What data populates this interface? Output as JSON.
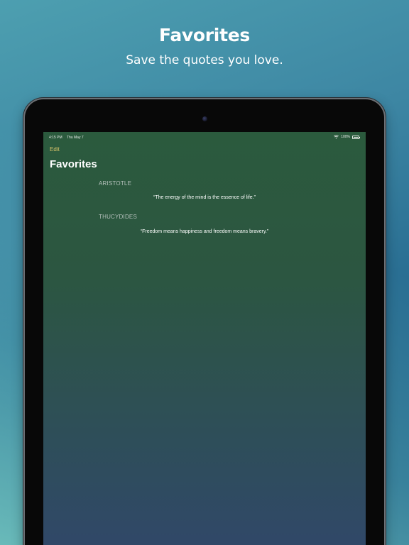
{
  "promo": {
    "headline": "Favorites",
    "subhead": "Save the quotes you love."
  },
  "status_bar": {
    "time": "4:15 PM",
    "date": "Thu May 7",
    "battery": "100%"
  },
  "nav": {
    "edit_label": "Edit",
    "title": "Favorites"
  },
  "favorites": [
    {
      "author": "ARISTOTLE",
      "quote": "“The energy of the mind is the essence of life.”"
    },
    {
      "author": "THUCYDIDES",
      "quote": "“Freedom means happiness and freedom means bravery.”"
    }
  ],
  "colors": {
    "accent": "#d9c56a",
    "screen_top": "#2b5a3d",
    "screen_bottom": "#304868",
    "author_text": "#b6c1bc"
  },
  "icons": {
    "wifi": "wifi-icon",
    "battery": "battery-icon",
    "camera": "front-camera"
  }
}
